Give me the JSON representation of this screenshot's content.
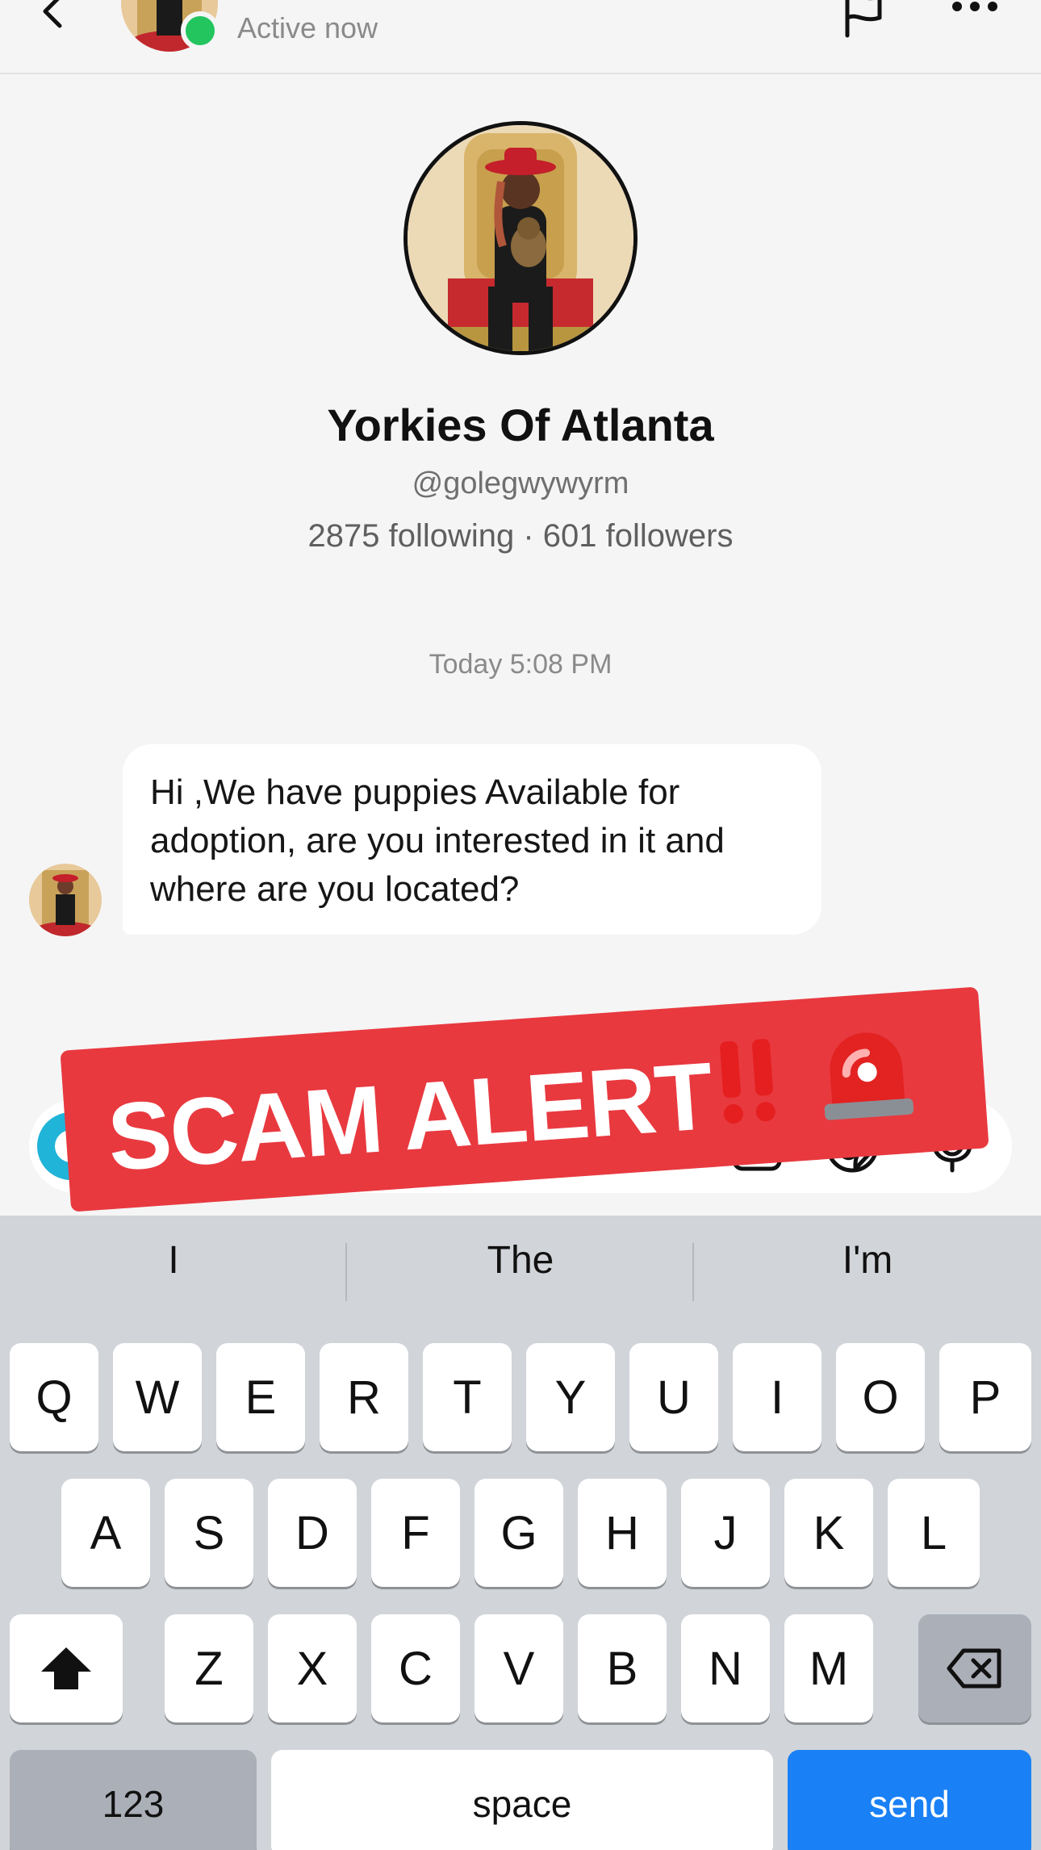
{
  "header": {
    "status": "Active now"
  },
  "profile": {
    "name": "Yorkies Of Atlanta",
    "handle": "@golegwywyrm",
    "stats": "2875 following · 601 followers"
  },
  "conversation": {
    "timestamp": "Today 5:08 PM",
    "messages": [
      {
        "text": "Hi ,We have puppies Available for adoption, are you interested in it and where are you located?"
      }
    ]
  },
  "overlay": {
    "text": "SCAM ALERT",
    "emoji": "‼️🚨"
  },
  "keyboard": {
    "suggestions": [
      "I",
      "The",
      "I'm"
    ],
    "row1": [
      "Q",
      "W",
      "E",
      "R",
      "T",
      "Y",
      "U",
      "I",
      "O",
      "P"
    ],
    "row2": [
      "A",
      "S",
      "D",
      "F",
      "G",
      "H",
      "J",
      "K",
      "L"
    ],
    "row3": [
      "Z",
      "X",
      "C",
      "V",
      "B",
      "N",
      "M"
    ],
    "numbers_label": "123",
    "space_label": "space",
    "send_label": "send"
  },
  "colors": {
    "online": "#22c55e",
    "banner": "#e8393f",
    "send_key": "#1a80f5"
  }
}
